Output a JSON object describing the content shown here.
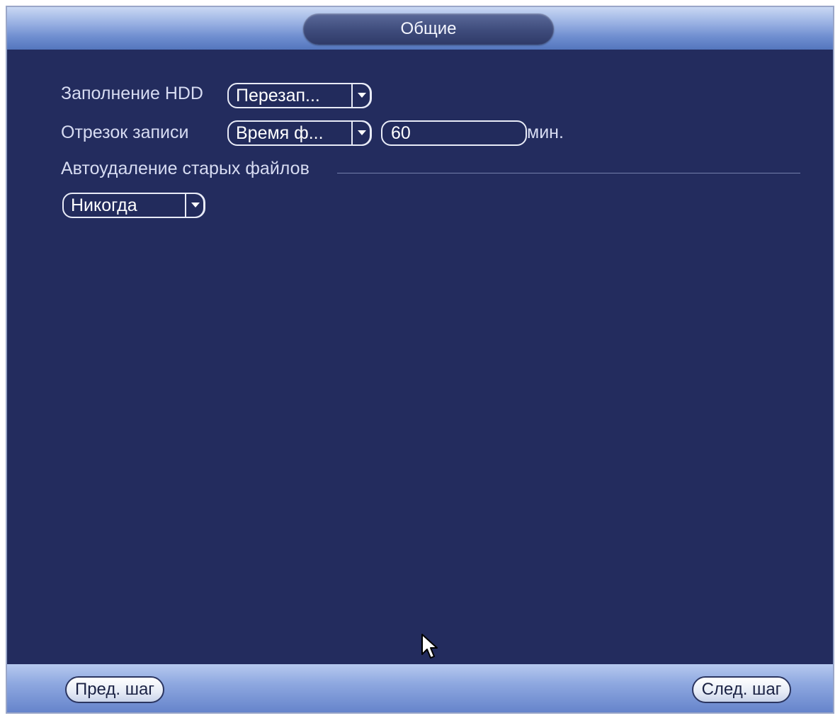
{
  "window": {
    "title": "Общие"
  },
  "settings": {
    "hdd_full": {
      "label": "Заполнение HDD",
      "value": "Перезап..."
    },
    "record_segment": {
      "label": "Отрезок записи",
      "mode": "Время ф...",
      "length": "60",
      "unit": "мин."
    },
    "auto_delete": {
      "section_label": "Автоудаление старых файлов",
      "value": "Никогда"
    }
  },
  "footer": {
    "prev_label": "Пред. шаг",
    "next_label": "След. шаг"
  },
  "icons": {
    "dropdown": "chevron-down-icon",
    "cursor": "mouse-pointer-icon"
  },
  "colors": {
    "background": "#232c5e",
    "text": "#d7dcf2",
    "titlebar": "#9db4e4"
  }
}
